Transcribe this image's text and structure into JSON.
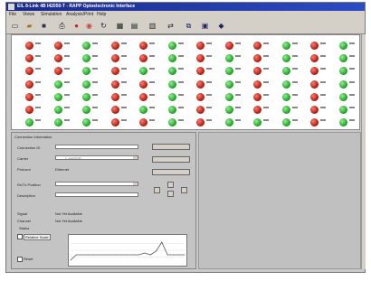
{
  "window": {
    "title": "EIL 8-Link 4B I42050-T - RAPP Optoelectronic Interface"
  },
  "menu": [
    {
      "label": "File"
    },
    {
      "label": "Views"
    },
    {
      "label": "Simulation"
    },
    {
      "label": "Analysis/Print"
    },
    {
      "label": "Help"
    }
  ],
  "toolbar": {
    "buttons": [
      {
        "icon": "new-file-icon"
      },
      {
        "icon": "open-folder-icon"
      },
      {
        "icon": "save-disk-icon"
      },
      {
        "icon": "print-icon"
      },
      {
        "icon": "stop-icon"
      },
      {
        "icon": "record-icon"
      },
      {
        "icon": "refresh-icon"
      },
      {
        "icon": "table-icon"
      },
      {
        "icon": "grid-icon"
      },
      {
        "icon": "chart-icon"
      },
      {
        "icon": "connect-icon"
      },
      {
        "icon": "network-icon"
      },
      {
        "icon": "monitor-icon"
      },
      {
        "icon": "info-icon"
      }
    ]
  },
  "led_columns": [
    [
      "red",
      "red",
      "red",
      "red",
      "red",
      "red",
      "green"
    ],
    [
      "red",
      "red",
      "red",
      "green",
      "green",
      "green",
      "green"
    ],
    [
      "green",
      "green",
      "green",
      "green",
      "green",
      "green",
      "green"
    ],
    [
      "red",
      "red",
      "red",
      "red",
      "red",
      "red",
      "red"
    ],
    [
      "red",
      "red",
      "green",
      "red",
      "red",
      "green",
      "red"
    ],
    [
      "green",
      "green",
      "green",
      "green",
      "green",
      "green",
      "green"
    ],
    [
      "red",
      "red",
      "red",
      "red",
      "red",
      "red",
      "red"
    ],
    [
      "red",
      "green",
      "green",
      "green",
      "green",
      "green",
      "green"
    ],
    [
      "red",
      "red",
      "red",
      "red",
      "red",
      "red",
      "green"
    ],
    [
      "green",
      "green",
      "green",
      "green",
      "green",
      "green",
      "green"
    ],
    [
      "red",
      "red",
      "red",
      "red",
      "red",
      "red",
      "red"
    ],
    [
      "green",
      "green",
      "green",
      "green",
      "green",
      "green",
      "green"
    ]
  ],
  "colors": {
    "led_red": "#a8150c",
    "led_green": "#1c9a22",
    "titlebar": "#1a2a8a",
    "graph_line": "#555555"
  },
  "form": {
    "section_title": "Connection Information",
    "labels": {
      "connection_id": "Connection ID",
      "carrier": "Carrier",
      "protocol": "Protocol",
      "rx_position": "Rx/Tx Position",
      "description": "Description",
      "signal": "Signal",
      "channel": "Channel",
      "status": "Status",
      "relative_scale": "Relative Scale",
      "reset": "Reset"
    },
    "values": {
      "carrier": "L_opto/OC3/I",
      "protocol": "Ethernet",
      "signal": "Not Yet Available",
      "channel": "Not Yet Available"
    }
  },
  "chart_data": {
    "type": "line",
    "title": "",
    "xlabel": "",
    "ylabel": "",
    "x": [
      0,
      5,
      10,
      15,
      20,
      25,
      30,
      35,
      40,
      45,
      50,
      55,
      60,
      65,
      70,
      75,
      80,
      85,
      90,
      95,
      100
    ],
    "series": [
      {
        "values": [
          2,
          5,
          5,
          5,
          5,
          5,
          5,
          5,
          5,
          5,
          5,
          5,
          5,
          6,
          5,
          7,
          12,
          5,
          5,
          5,
          5
        ]
      }
    ],
    "ylim": [
      0,
      15
    ],
    "grid": true
  }
}
